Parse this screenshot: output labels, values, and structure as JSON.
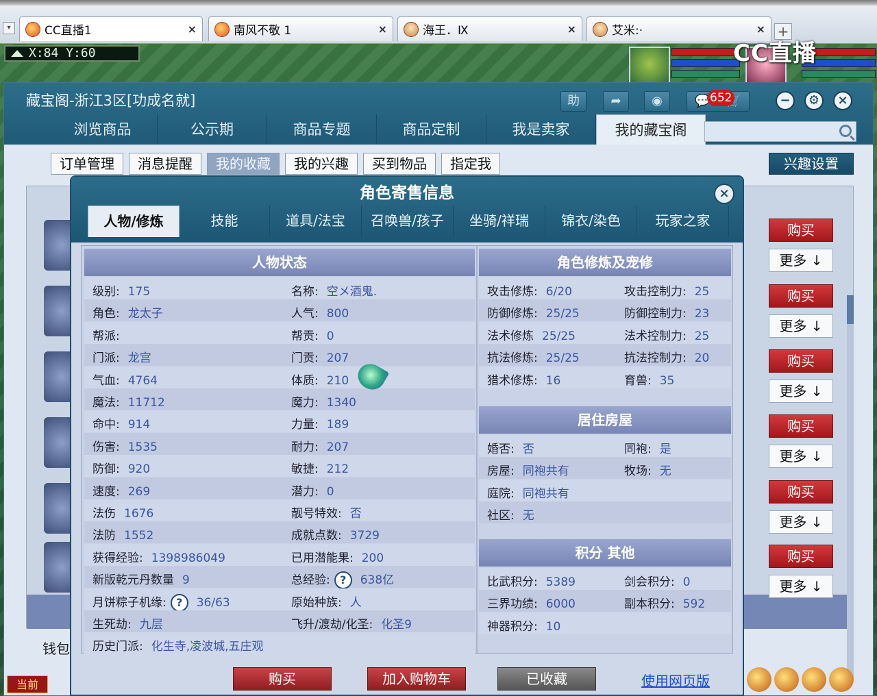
{
  "browser": {
    "tabs": [
      {
        "label": "CC直播1",
        "icon": "cc-flame-icon"
      },
      {
        "label": "南风不敬 1",
        "icon": "cc-flame-icon"
      },
      {
        "label": "海王．Ⅸ",
        "icon": "avatar-face-icon"
      },
      {
        "label": "艾米:·",
        "icon": "avatar-face-icon"
      }
    ],
    "watermark": "CC直播"
  },
  "scene": {
    "coords": "X:84  Y:60",
    "current_label": "当前"
  },
  "window": {
    "title": "藏宝阁-浙江3区[功成名就]",
    "help_label": "助",
    "message_count": "652",
    "nav_tabs": [
      "浏览商品",
      "公示期",
      "商品专题",
      "商品定制",
      "我是卖家",
      "我的藏宝阁"
    ],
    "nav_active": 5,
    "sub_tabs": [
      "订单管理",
      "消息提醒",
      "我的收藏",
      "我的兴趣",
      "买到物品",
      "指定我"
    ],
    "sub_active": 2,
    "interest_settings": "兴趣设置",
    "wallet_label": "钱包",
    "side_buttons": {
      "buy": "购买",
      "more": "更多 ↓"
    }
  },
  "dialog": {
    "title": "角色寄售信息",
    "tabs": [
      "人物/修炼",
      "技能",
      "道具/法宝",
      "召唤兽/孩子",
      "坐骑/祥瑞",
      "锦衣/染色",
      "玩家之家"
    ],
    "active_tab": 0,
    "status_panel": {
      "title": "人物状态",
      "rows": [
        [
          {
            "label": "级别:",
            "value": "175"
          },
          {
            "label": "名称:",
            "value": "空メ酒鬼."
          }
        ],
        [
          {
            "label": "角色:",
            "value": "龙太子"
          },
          {
            "label": "人气:",
            "value": "800"
          }
        ],
        [
          {
            "label": "帮派:",
            "value": ""
          },
          {
            "label": "帮贡:",
            "value": "0"
          }
        ],
        [
          {
            "label": "门派:",
            "value": "龙宫"
          },
          {
            "label": "门贡:",
            "value": "207"
          }
        ],
        [
          {
            "label": "气血:",
            "value": "4764"
          },
          {
            "label": "体质:",
            "value": "210"
          }
        ],
        [
          {
            "label": "魔法:",
            "value": "11712"
          },
          {
            "label": "魔力:",
            "value": "1340"
          }
        ],
        [
          {
            "label": "命中:",
            "value": "914"
          },
          {
            "label": "力量:",
            "value": "189"
          }
        ],
        [
          {
            "label": "伤害:",
            "value": "1535"
          },
          {
            "label": "耐力:",
            "value": "207"
          }
        ],
        [
          {
            "label": "防御:",
            "value": "920"
          },
          {
            "label": "敏捷:",
            "value": "212"
          }
        ],
        [
          {
            "label": "速度:",
            "value": "269"
          },
          {
            "label": "潜力:",
            "value": "0"
          }
        ],
        [
          {
            "label": "法伤",
            "value": "1676"
          },
          {
            "label": "靓号特效:",
            "value": "否"
          }
        ],
        [
          {
            "label": "法防",
            "value": "1552"
          },
          {
            "label": "成就点数:",
            "value": "3729"
          }
        ],
        [
          {
            "label": "获得经验:",
            "value": "1398986049"
          },
          {
            "label": "已用潜能果:",
            "value": "200"
          }
        ],
        [
          {
            "label": "新版乾元丹数量",
            "value": "9"
          },
          {
            "label": "总经验:",
            "value": "638亿",
            "help": true
          }
        ],
        [
          {
            "label": "月饼粽子机缘:",
            "value": "36/63",
            "help": true
          },
          {
            "label": "原始种族:",
            "value": "人"
          }
        ],
        [
          {
            "label": "生死劫:",
            "value": "九层"
          },
          {
            "label": "飞升/渡劫/化圣:",
            "value": "化圣9"
          }
        ],
        [
          {
            "label": "历史门派:",
            "value": "化生寺,凌波城,五庄观"
          }
        ]
      ]
    },
    "cultivation_panel": {
      "title": "角色修炼及宠修",
      "rows": [
        [
          {
            "label": "攻击修炼:",
            "value": "6/20"
          },
          {
            "label": "攻击控制力:",
            "value": "25"
          }
        ],
        [
          {
            "label": "防御修炼:",
            "value": "25/25"
          },
          {
            "label": "防御控制力:",
            "value": "23"
          }
        ],
        [
          {
            "label": "法术修炼",
            "value": "25/25"
          },
          {
            "label": "法术控制力:",
            "value": "25"
          }
        ],
        [
          {
            "label": "抗法修炼:",
            "value": "25/25"
          },
          {
            "label": "抗法控制力:",
            "value": "20"
          }
        ],
        [
          {
            "label": "猎术修炼:",
            "value": "16"
          },
          {
            "label": "育兽:",
            "value": "35"
          }
        ]
      ]
    },
    "housing_panel": {
      "title": "居住房屋",
      "rows": [
        [
          {
            "label": "婚否:",
            "value": "否"
          },
          {
            "label": "同袍:",
            "value": "是"
          }
        ],
        [
          {
            "label": "房屋:",
            "value": "同袍共有"
          },
          {
            "label": "牧场:",
            "value": "无"
          }
        ],
        [
          {
            "label": "庭院:",
            "value": "同袍共有"
          }
        ],
        [
          {
            "label": "社区:",
            "value": "无"
          }
        ]
      ]
    },
    "points_panel": {
      "title": "积分 其他",
      "rows": [
        [
          {
            "label": "比武积分:",
            "value": "5389"
          },
          {
            "label": "剑会积分:",
            "value": "0"
          }
        ],
        [
          {
            "label": "三界功绩:",
            "value": "6000"
          },
          {
            "label": "副本积分:",
            "value": "592"
          }
        ],
        [
          {
            "label": "神器积分:",
            "value": "10"
          }
        ]
      ]
    },
    "actions": {
      "buy": "购买",
      "add_cart": "加入购物车",
      "favorited": "已收藏",
      "web_version": "使用网页版"
    }
  }
}
